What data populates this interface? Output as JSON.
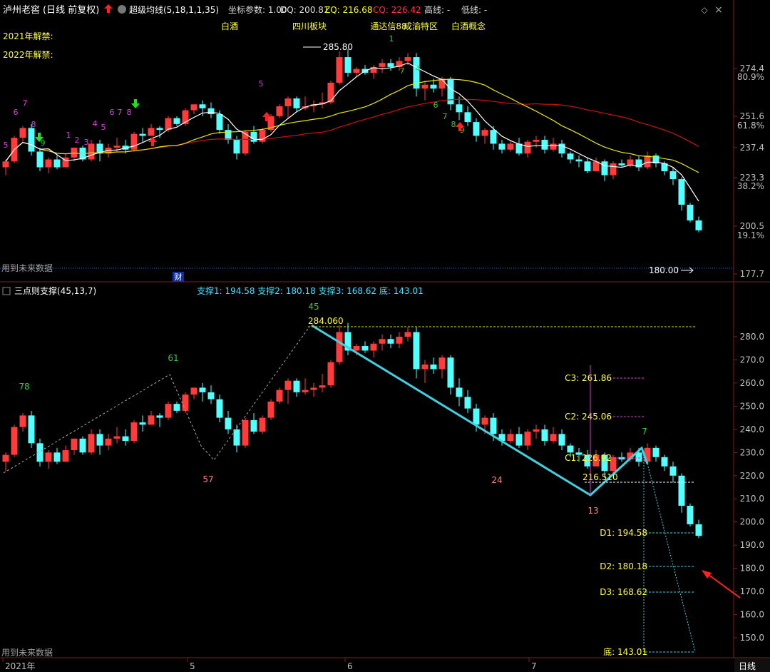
{
  "top_panel": {
    "stock_name": "泸州老窖",
    "period_label": "(日线 前复权)",
    "indicator_name": "超级均线(5,18,1,1,35)",
    "params": [
      {
        "label": "坐标参数: 1.00",
        "color": "#dddddd"
      },
      {
        "label": "DQ: 200.81",
        "color": "#dddddd"
      },
      {
        "label": "ZQ: 216.68",
        "color": "#ffff00"
      },
      {
        "label": "CQ: 226.42",
        "color": "#ff3333"
      },
      {
        "label": "高线: -",
        "color": "#dddddd"
      },
      {
        "label": "低线: -",
        "color": "#dddddd"
      }
    ],
    "concepts": [
      "白酒",
      "四川板块",
      "通达信88",
      "成渝特区",
      "白酒概念"
    ],
    "unlock_2021": "2021年解禁:",
    "unlock_2022": "2022年解禁:",
    "future_data": "用到未来数据",
    "cai_marker": "财",
    "high_label": "285.80",
    "low_label": "180.00",
    "y_ticks": [
      "274.4",
      "251.6",
      "237.4",
      "223.3",
      "200.5",
      "177.7"
    ],
    "pct_ticks": [
      "80.9%",
      "61.8%",
      "38.2%",
      "19.1%"
    ],
    "td_counts_red": [
      "5",
      "6",
      "7",
      "8",
      "1",
      "2",
      "3",
      "4",
      "5",
      "6",
      "7",
      "8",
      "5"
    ],
    "td_counts_green": [
      "9",
      "1",
      "7",
      "4",
      "6",
      "7",
      "8",
      "9"
    ]
  },
  "bottom_panel": {
    "indicator_name": "三点则支撑(45,13,7)",
    "support_text": "支撑1: 194.58  支撑2: 180.18  支撑3: 168.62  底: 143.01",
    "future_data": "用到未来数据",
    "peak_value": "284.060",
    "count_labels": [
      "78",
      "61",
      "45",
      "57",
      "24",
      "13",
      "7"
    ],
    "c_labels": [
      "C3: 261.86",
      "C2: 245.06",
      "C1: 226.92"
    ],
    "line_216": "216.510",
    "d_labels": [
      "D1: 194.58",
      "D2: 180.18",
      "D3: 168.62",
      "底: 143.01"
    ],
    "y_ticks": [
      "280.0",
      "270.0",
      "260.0",
      "250.0",
      "240.0",
      "230.0",
      "220.0",
      "210.0",
      "200.0",
      "190.0",
      "180.0",
      "170.0",
      "160.0",
      "150.0"
    ]
  },
  "x_axis": {
    "labels": [
      "2021年",
      "5",
      "6",
      "7"
    ],
    "period_button": "日线"
  },
  "window_controls": {
    "diamond": "◇",
    "close": "×"
  },
  "colors": {
    "up": "#ff3b3b",
    "down": "#54ffff",
    "ma_white": "#ffffff",
    "ma_yellow": "#e8e800",
    "ma_red": "#d01010",
    "support_line": "#40d0e0"
  },
  "chart_data": {
    "type": "candlestick",
    "ylim": [
      174,
      290
    ],
    "candles": [
      [
        226,
        230,
        222,
        229
      ],
      [
        229,
        242,
        228,
        241
      ],
      [
        241,
        247,
        239,
        246
      ],
      [
        246,
        248,
        232,
        234
      ],
      [
        234,
        236,
        224,
        226
      ],
      [
        226,
        231,
        223,
        230
      ],
      [
        230,
        232,
        225,
        226
      ],
      [
        226,
        233,
        226,
        231
      ],
      [
        231,
        236,
        229,
        236
      ],
      [
        236,
        237,
        229,
        230
      ],
      [
        230,
        240,
        229,
        238
      ],
      [
        238,
        240,
        229,
        233
      ],
      [
        233,
        238,
        231,
        236
      ],
      [
        236,
        241,
        234,
        237
      ],
      [
        237,
        240,
        233,
        235
      ],
      [
        235,
        244,
        234,
        243
      ],
      [
        243,
        246,
        239,
        242
      ],
      [
        242,
        248,
        242,
        246
      ],
      [
        246,
        247,
        241,
        245
      ],
      [
        245,
        252,
        244,
        251
      ],
      [
        251,
        252,
        247,
        248
      ],
      [
        248,
        256,
        247,
        255
      ],
      [
        255,
        258,
        253,
        258
      ],
      [
        258,
        260,
        252,
        256
      ],
      [
        256,
        259,
        251,
        253
      ],
      [
        253,
        255,
        243,
        245
      ],
      [
        245,
        248,
        238,
        240
      ],
      [
        240,
        242,
        230,
        233
      ],
      [
        233,
        245,
        232,
        244
      ],
      [
        244,
        247,
        238,
        239
      ],
      [
        239,
        246,
        238,
        245
      ],
      [
        245,
        253,
        244,
        252
      ],
      [
        252,
        258,
        251,
        257
      ],
      [
        257,
        262,
        251,
        261
      ],
      [
        261,
        262,
        254,
        256
      ],
      [
        256,
        262,
        255,
        257
      ],
      [
        257,
        260,
        254,
        258
      ],
      [
        258,
        264,
        256,
        259
      ],
      [
        259,
        270,
        258,
        269
      ],
      [
        269,
        285,
        268,
        282
      ],
      [
        282,
        286,
        272,
        274
      ],
      [
        274,
        277,
        272,
        276
      ],
      [
        276,
        278,
        273,
        274
      ],
      [
        274,
        278,
        271,
        277
      ],
      [
        277,
        281,
        274,
        279
      ],
      [
        279,
        281,
        275,
        277
      ],
      [
        277,
        282,
        275,
        280
      ],
      [
        280,
        284,
        278,
        282
      ],
      [
        282,
        284,
        262,
        266
      ],
      [
        266,
        270,
        260,
        268
      ],
      [
        268,
        271,
        264,
        266
      ],
      [
        266,
        272,
        262,
        271
      ],
      [
        271,
        272,
        255,
        258
      ],
      [
        258,
        262,
        250,
        254
      ],
      [
        254,
        257,
        247,
        249
      ],
      [
        249,
        251,
        239,
        242
      ],
      [
        242,
        246,
        238,
        245
      ],
      [
        245,
        247,
        235,
        238
      ],
      [
        238,
        240,
        233,
        235
      ],
      [
        235,
        240,
        234,
        238
      ],
      [
        238,
        241,
        232,
        233
      ],
      [
        233,
        240,
        231,
        239
      ],
      [
        239,
        242,
        236,
        240
      ],
      [
        240,
        242,
        233,
        235
      ],
      [
        235,
        241,
        234,
        238
      ],
      [
        238,
        240,
        231,
        233
      ],
      [
        233,
        234,
        228,
        230
      ],
      [
        230,
        232,
        226,
        229
      ],
      [
        229,
        231,
        223,
        224
      ],
      [
        224,
        231,
        224,
        229
      ],
      [
        229,
        230,
        219,
        222
      ],
      [
        222,
        229,
        220,
        228
      ],
      [
        228,
        230,
        226,
        227
      ],
      [
        227,
        232,
        226,
        230
      ],
      [
        230,
        232,
        224,
        226
      ],
      [
        226,
        234,
        225,
        232
      ],
      [
        232,
        233,
        226,
        228
      ],
      [
        228,
        229,
        222,
        224
      ],
      [
        224,
        226,
        217,
        220
      ],
      [
        220,
        221,
        204,
        207
      ],
      [
        207,
        208,
        198,
        199
      ],
      [
        199,
        201,
        193,
        194
      ]
    ]
  }
}
